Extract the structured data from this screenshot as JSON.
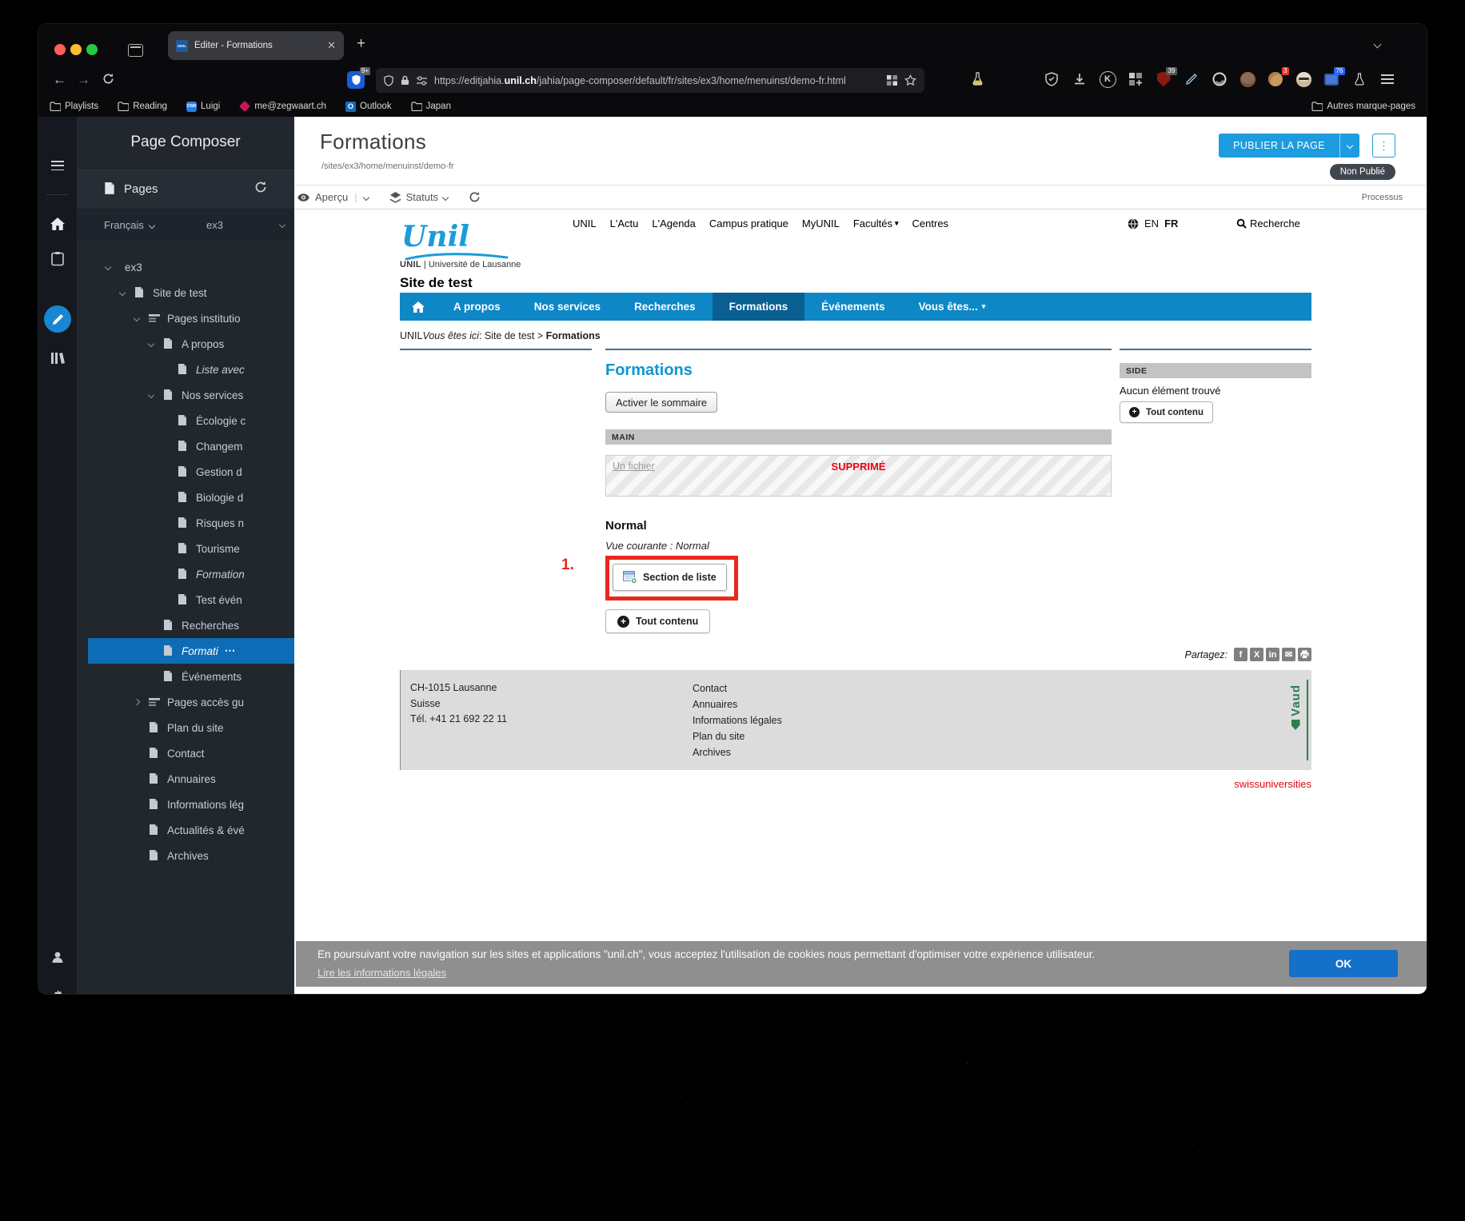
{
  "browser": {
    "tab_title": "Editer - Formations",
    "favicon_text": "UNIL",
    "url_prefix": "https://editjahia.",
    "url_domain": "unil.ch",
    "url_path": "/jahia/page-composer/default/fr/sites/ex3/home/menuinst/demo-fr.html",
    "bitwarden_badge": "9+",
    "bookmarks": [
      {
        "label": "Playlists",
        "icon": "folder"
      },
      {
        "label": "Reading",
        "icon": "folder"
      },
      {
        "label": "Luigi",
        "icon": "dsm",
        "chip": "DSM"
      },
      {
        "label": "me@zegwaart.ch",
        "icon": "mail"
      },
      {
        "label": "Outlook",
        "icon": "outlook",
        "chip": "O"
      },
      {
        "label": "Japan",
        "icon": "folder"
      }
    ],
    "bookmarks_overflow": "Autres marque-pages",
    "ext_icons": [
      {
        "name": "shield-check-icon"
      },
      {
        "name": "download-icon"
      },
      {
        "name": "kagi-icon",
        "glyph": "K"
      },
      {
        "name": "blocks-icon"
      },
      {
        "name": "ublock-icon",
        "badge": "39"
      },
      {
        "name": "pen-icon"
      },
      {
        "name": "arc-icon"
      },
      {
        "name": "avatar-icon"
      },
      {
        "name": "cookie-icon",
        "badge": "3"
      },
      {
        "name": "avatar2-icon"
      },
      {
        "name": "monitor-icon",
        "badge": "76"
      },
      {
        "name": "flask2-icon"
      },
      {
        "name": "menu-icon"
      }
    ]
  },
  "composer": {
    "app_title": "Page Composer",
    "panel_title": "Pages",
    "language": "Français",
    "site_key": "ex3",
    "tree": [
      {
        "label": "ex3",
        "level": 0,
        "expander": "open"
      },
      {
        "label": "Site de test",
        "level": 1,
        "expander": "open",
        "icon": "page"
      },
      {
        "label": "Pages institutio",
        "level": 2,
        "expander": "open",
        "icon": "menu"
      },
      {
        "label": "A propos",
        "level": 3,
        "expander": "open",
        "icon": "page"
      },
      {
        "label": "Liste avec",
        "level": 4,
        "icon": "page",
        "italic": true
      },
      {
        "label": "Nos services",
        "level": 3,
        "expander": "open",
        "icon": "page"
      },
      {
        "label": "Écologie c",
        "level": 4,
        "icon": "page"
      },
      {
        "label": "Changem",
        "level": 4,
        "icon": "page"
      },
      {
        "label": "Gestion d",
        "level": 4,
        "icon": "page"
      },
      {
        "label": "Biologie d",
        "level": 4,
        "icon": "page"
      },
      {
        "label": "Risques n",
        "level": 4,
        "icon": "page"
      },
      {
        "label": "Tourisme",
        "level": 4,
        "icon": "page"
      },
      {
        "label": "Formation",
        "level": 4,
        "icon": "page",
        "italic": true
      },
      {
        "label": "Test évén",
        "level": 4,
        "icon": "page"
      },
      {
        "label": "Recherches",
        "level": 3,
        "icon": "page"
      },
      {
        "label": "Formati",
        "level": 3,
        "icon": "page",
        "italic": true,
        "selected": true,
        "more": "⋯"
      },
      {
        "label": "Événements",
        "level": 3,
        "icon": "page"
      },
      {
        "label": "Pages accès gu",
        "level": 2,
        "expander": "closed",
        "icon": "menu"
      },
      {
        "label": "Plan du site",
        "level": 2,
        "icon": "page"
      },
      {
        "label": "Contact",
        "level": 2,
        "icon": "page"
      },
      {
        "label": "Annuaires",
        "level": 2,
        "icon": "page"
      },
      {
        "label": "Informations lég",
        "level": 2,
        "icon": "page"
      },
      {
        "label": "Actualités & évé",
        "level": 2,
        "icon": "page"
      },
      {
        "label": "Archives",
        "level": 2,
        "icon": "page"
      }
    ]
  },
  "header": {
    "title": "Formations",
    "path": "/sites/ex3/home/menuinst/demo-fr",
    "publish_label": "PUBLIER LA PAGE",
    "status_badge": "Non Publié"
  },
  "jtoolbar": {
    "preview": "Aperçu",
    "statuses": "Statuts",
    "process": "Processus"
  },
  "site": {
    "logo_script": "Unil",
    "logo_sub_bold": "UNIL",
    "logo_sub_rest": " | Université de Lausanne",
    "top_nav": [
      "UNIL",
      "L'Actu",
      "L'Agenda",
      "Campus pratique",
      "MyUNIL",
      "Facultés",
      "Centres"
    ],
    "lang_en": "EN",
    "lang_fr": "FR",
    "search_label": "Recherche",
    "site_title": "Site de test",
    "main_nav": [
      {
        "label": "A propos"
      },
      {
        "label": "Nos services"
      },
      {
        "label": "Recherches"
      },
      {
        "label": "Formations",
        "active": true
      },
      {
        "label": "Événements"
      },
      {
        "label": "Vous êtes...",
        "dropdown": true
      }
    ],
    "breadcrumb": {
      "prefix": "UNIL",
      "here": "Vous êtes ici",
      "sep": ": ",
      "path": "Site de test > ",
      "current": "Formations"
    },
    "page_heading": "Formations",
    "summary_button": "Activer le sommaire",
    "main_zone": "MAIN",
    "deleted_item": "Un fichier",
    "deleted_status": "SUPPRIMÉ",
    "view_heading": "Normal",
    "view_caption": "Vue courante : Normal",
    "annotation": "1.",
    "add_section_button": "Section de liste",
    "all_content_button": "Tout contenu",
    "side_zone": "SIDE",
    "side_empty": "Aucun élément trouvé",
    "side_all_content": "Tout contenu",
    "share_label": "Partagez:",
    "share_icons": [
      "f",
      "X",
      "in",
      "mail",
      "print"
    ],
    "footer_address": [
      "CH-1015 Lausanne",
      "Suisse",
      "Tél. +41 21 692 22 11"
    ],
    "footer_links": [
      "Contact",
      "Annuaires",
      "Informations légales",
      "Plan du site",
      "Archives"
    ],
    "vaud_logo": "Vaud",
    "swiss_logo": "swissuniversities"
  },
  "cookie": {
    "message": "En poursuivant votre navigation sur les sites et applications \"unil.ch\", vous acceptez l'utilisation de cookies nous permettant d'optimiser votre expérience utilisateur.",
    "link": "Lire les informations légales",
    "ok": "OK"
  }
}
